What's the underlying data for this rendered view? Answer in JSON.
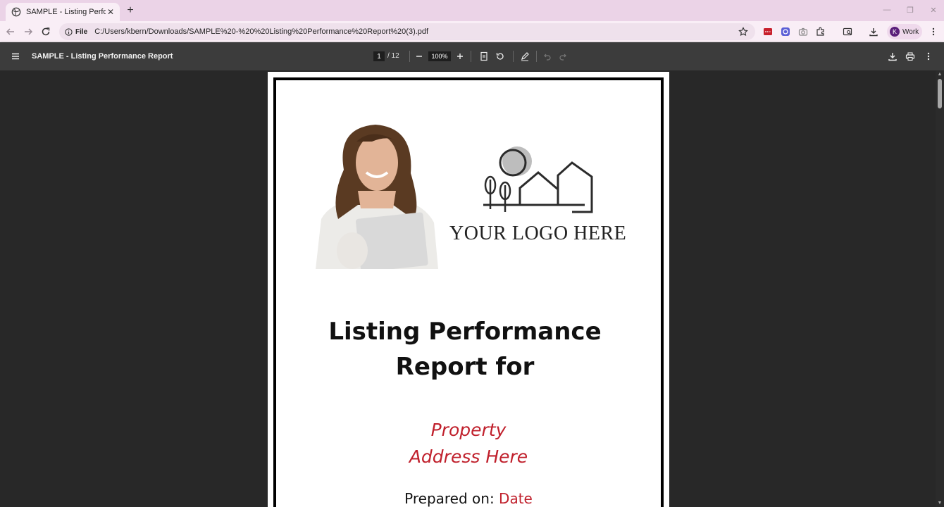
{
  "browser": {
    "tab_title": "SAMPLE - Listing Performance R",
    "omnibox_chip": "File",
    "url": "C:/Users/kbern/Downloads/SAMPLE%20-%20%20Listing%20Performance%20Report%20(3).pdf",
    "profile_initial": "K",
    "profile_label": "Work"
  },
  "pdf_viewer": {
    "title": "SAMPLE - Listing Performance Report",
    "current_page": "1",
    "page_total": "/ 12",
    "zoom": "100%"
  },
  "document": {
    "logo_text": "YOUR LOGO HERE",
    "heading_line1": "Listing Performance",
    "heading_line2": "Report for",
    "address_line1": "Property",
    "address_line2": "Address Here",
    "prepared_label": "Prepared on: ",
    "prepared_date": "Date"
  },
  "colors": {
    "tabstrip": "#ebd3e7",
    "toolbar": "#f9eef6",
    "pdf_bar": "#3c3c3c",
    "viewer_bg": "#282828",
    "accent_red": "#c0202c",
    "profile_avatar": "#5a1e7a"
  }
}
